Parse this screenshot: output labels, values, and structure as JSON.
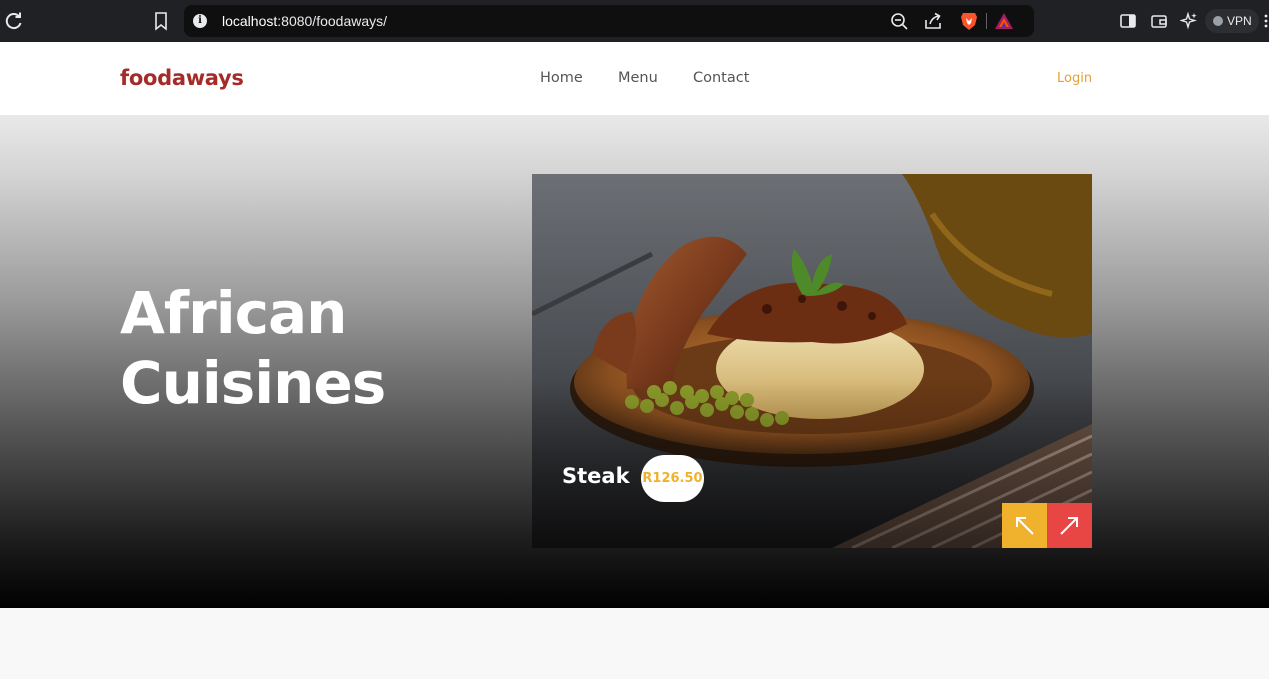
{
  "browser": {
    "url_host": "localhost",
    "url_rest": ":8080/foodaways/",
    "vpn_label": "VPN",
    "icons": [
      "reload-icon",
      "bookmark-icon",
      "info-icon",
      "zoom-icon",
      "share-icon",
      "brave-shields-icon",
      "bat-rewards-icon",
      "sidebar-icon",
      "wallet-icon",
      "leo-icon",
      "menu-icon"
    ]
  },
  "header": {
    "brand": "foodaways",
    "nav": [
      {
        "label": "Home"
      },
      {
        "label": "Menu"
      },
      {
        "label": "Contact"
      }
    ],
    "login_label": "Login"
  },
  "hero": {
    "title_line1": "African",
    "title_line2": "Cuisines",
    "slide": {
      "dish_name": "Steak",
      "price": "R126.50",
      "prev_icon": "arrow-up-left-icon",
      "next_icon": "arrow-up-right-icon"
    }
  },
  "colors": {
    "brand": "#a52a2a",
    "login": "#e5a035",
    "price": "#f0b22c",
    "prev_button": "#f0b22c",
    "next_button": "#e84545"
  }
}
